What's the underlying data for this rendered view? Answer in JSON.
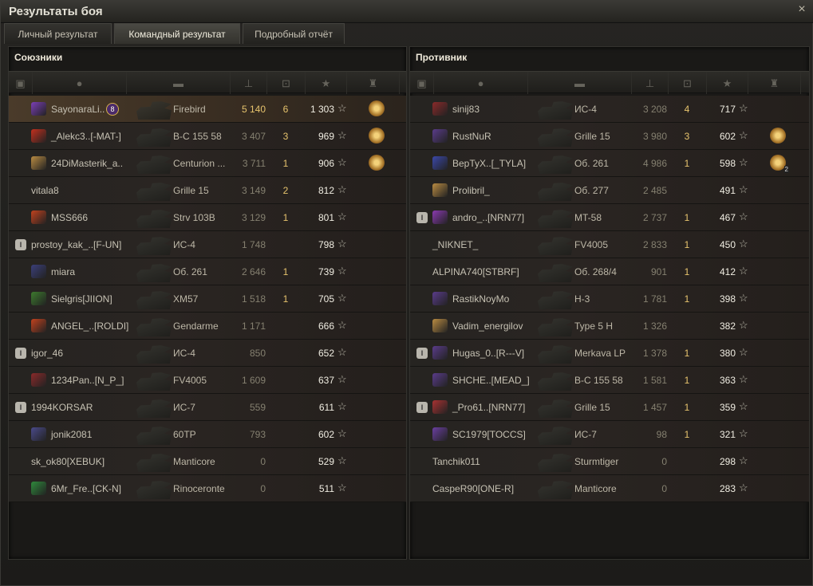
{
  "window": {
    "title": "Результаты боя",
    "close_icon": "×"
  },
  "tabs": [
    {
      "label": "Личный результат"
    },
    {
      "label": "Командный результат",
      "active": true
    },
    {
      "label": "Подробный отчёт"
    }
  ],
  "colors": {
    "accent_gold": "#e6c36d",
    "highlight_row": "#4a3b2a"
  },
  "allies": {
    "title": "Союзники",
    "header_icons": [
      "platoon-icon",
      "player-icon",
      "tank-icon",
      "damage-icon",
      "kills-icon",
      "xp-icon",
      "medal-icon"
    ],
    "rows": [
      {
        "name": "SayonaraLi..",
        "platoon": "",
        "clan_color": "#7b3fb6",
        "badge": "8",
        "tank": "Firebird",
        "damage": "5 140",
        "kills": "6",
        "xp": "1 303",
        "medal": true,
        "medal_count": "",
        "me": true
      },
      {
        "name": "_Alekc3..[-MAT-]",
        "platoon": "",
        "clan_color": "#c4301e",
        "badge": "",
        "tank": "B-C 155 58",
        "damage": "3 407",
        "kills": "3",
        "xp": "969",
        "medal": true,
        "medal_count": ""
      },
      {
        "name": "24DiMasterik_a..",
        "platoon": "",
        "clan_color": "#b98b42",
        "badge": "",
        "tank": "Centurion ...",
        "damage": "3 711",
        "kills": "1",
        "xp": "906",
        "medal": true,
        "medal_count": ""
      },
      {
        "name": "vitala8",
        "platoon": "",
        "clan_color": "",
        "badge": "",
        "tank": "Grille 15",
        "damage": "3 149",
        "kills": "2",
        "xp": "812",
        "medal": false,
        "medal_count": ""
      },
      {
        "name": "MSS666",
        "platoon": "",
        "clan_color": "#c2421e",
        "badge": "",
        "tank": "Strv 103B",
        "damage": "3 129",
        "kills": "1",
        "xp": "801",
        "medal": false,
        "medal_count": ""
      },
      {
        "name": "prostoy_kak_..[F-UN]",
        "platoon": "I",
        "clan_color": "",
        "badge": "",
        "tank": "ИС-4",
        "damage": "1 748",
        "kills": "",
        "xp": "798",
        "medal": false,
        "medal_count": ""
      },
      {
        "name": "miara",
        "platoon": "",
        "clan_color": "#3b3f7a",
        "badge": "",
        "tank": "Об. 261",
        "damage": "2 646",
        "kills": "1",
        "xp": "739",
        "medal": false,
        "medal_count": ""
      },
      {
        "name": "Sielgris[JIION]",
        "platoon": "",
        "clan_color": "#3d7a2e",
        "badge": "",
        "tank": "XM57",
        "damage": "1 518",
        "kills": "1",
        "xp": "705",
        "medal": false,
        "medal_count": ""
      },
      {
        "name": "ANGEL_..[ROLDI]",
        "platoon": "",
        "clan_color": "#c2421e",
        "badge": "",
        "tank": "Gendarme",
        "damage": "1 171",
        "kills": "",
        "xp": "666",
        "medal": false,
        "medal_count": ""
      },
      {
        "name": "igor_46",
        "platoon": "I",
        "clan_color": "",
        "badge": "",
        "tank": "ИС-4",
        "damage": "850",
        "kills": "",
        "xp": "652",
        "medal": false,
        "medal_count": ""
      },
      {
        "name": "1234Pan..[N_P_]",
        "platoon": "",
        "clan_color": "#8a2a2a",
        "badge": "",
        "tank": "FV4005",
        "damage": "1 609",
        "kills": "",
        "xp": "637",
        "medal": false,
        "medal_count": ""
      },
      {
        "name": "1994KORSAR",
        "platoon": "I",
        "clan_color": "",
        "badge": "",
        "tank": "ИС-7",
        "damage": "559",
        "kills": "",
        "xp": "611",
        "medal": false,
        "medal_count": ""
      },
      {
        "name": "jonik2081",
        "platoon": "",
        "clan_color": "#4a4a8a",
        "badge": "",
        "tank": "60TP",
        "damage": "793",
        "kills": "",
        "xp": "602",
        "medal": false,
        "medal_count": ""
      },
      {
        "name": "sk_ok80[XEBUK]",
        "platoon": "",
        "clan_color": "",
        "badge": "",
        "tank": "Manticore",
        "damage": "0",
        "kills": "",
        "xp": "529",
        "medal": false,
        "medal_count": ""
      },
      {
        "name": "6Mr_Fre..[CK-N]",
        "platoon": "",
        "clan_color": "#2f8a3c",
        "badge": "",
        "tank": "Rinoceronte",
        "damage": "0",
        "kills": "",
        "xp": "511",
        "medal": false,
        "medal_count": ""
      }
    ]
  },
  "enemies": {
    "title": "Противник",
    "header_icons": [
      "platoon-icon",
      "player-icon",
      "tank-icon",
      "damage-icon",
      "kills-icon",
      "xp-icon",
      "medal-icon"
    ],
    "rows": [
      {
        "name": "sinij83",
        "platoon": "",
        "clan_color": "#8a2a2a",
        "tank": "ИС-4",
        "damage": "3 208",
        "kills": "4",
        "xp": "717",
        "medal": false,
        "medal_count": ""
      },
      {
        "name": "RustNuR",
        "platoon": "",
        "clan_color": "#5a3c8a",
        "tank": "Grille 15",
        "damage": "3 980",
        "kills": "3",
        "xp": "602",
        "medal": true,
        "medal_count": ""
      },
      {
        "name": "ВерТуХ..[_TYLA]",
        "platoon": "",
        "clan_color": "#3b48a8",
        "tank": "Об. 261",
        "damage": "4 986",
        "kills": "1",
        "xp": "598",
        "medal": true,
        "medal_count": "2"
      },
      {
        "name": "Prolibril_",
        "platoon": "",
        "clan_color": "#b98b42",
        "tank": "Об. 277",
        "damage": "2 485",
        "kills": "",
        "xp": "491",
        "medal": false,
        "medal_count": ""
      },
      {
        "name": "andro_..[NRN77]",
        "platoon": "I",
        "clan_color": "#8a3ab0",
        "tank": "MT-58",
        "damage": "2 737",
        "kills": "1",
        "xp": "467",
        "medal": false,
        "medal_count": ""
      },
      {
        "name": "_NIKNET_",
        "platoon": "",
        "clan_color": "",
        "tank": "FV4005",
        "damage": "2 833",
        "kills": "1",
        "xp": "450",
        "medal": false,
        "medal_count": ""
      },
      {
        "name": "ALPINA740[STBRF]",
        "platoon": "",
        "clan_color": "",
        "tank": "Об. 268/4",
        "damage": "901",
        "kills": "1",
        "xp": "412",
        "medal": false,
        "medal_count": ""
      },
      {
        "name": "RastikNoyMo",
        "platoon": "",
        "clan_color": "#5a3c8a",
        "tank": "H-3",
        "damage": "1 781",
        "kills": "1",
        "xp": "398",
        "medal": false,
        "medal_count": ""
      },
      {
        "name": "Vadim_energilov",
        "platoon": "",
        "clan_color": "#b98b42",
        "tank": "Type 5 H",
        "damage": "1 326",
        "kills": "",
        "xp": "382",
        "medal": false,
        "medal_count": ""
      },
      {
        "name": "Hugas_0..[R---V]",
        "platoon": "I",
        "clan_color": "#5a3c8a",
        "tank": "Merkava LP",
        "damage": "1 378",
        "kills": "1",
        "xp": "380",
        "medal": false,
        "medal_count": ""
      },
      {
        "name": "SHCHE..[MEAD_]",
        "platoon": "",
        "clan_color": "#5a3c8a",
        "tank": "B-C 155 58",
        "damage": "1 581",
        "kills": "1",
        "xp": "363",
        "medal": false,
        "medal_count": ""
      },
      {
        "name": "_Pro61..[NRN77]",
        "platoon": "I",
        "clan_color": "#a83232",
        "tank": "Grille 15",
        "damage": "1 457",
        "kills": "1",
        "xp": "359",
        "medal": false,
        "medal_count": ""
      },
      {
        "name": "SC1979[TOCCS]",
        "platoon": "",
        "clan_color": "#6a3fa0",
        "tank": "ИС-7",
        "damage": "98",
        "kills": "1",
        "xp": "321",
        "medal": false,
        "medal_count": ""
      },
      {
        "name": "Tanchik011",
        "platoon": "",
        "clan_color": "",
        "tank": "Sturmtiger",
        "damage": "0",
        "kills": "",
        "xp": "298",
        "medal": false,
        "medal_count": ""
      },
      {
        "name": "CaspeR90[ONE-R]",
        "platoon": "",
        "clan_color": "",
        "tank": "Manticore",
        "damage": "0",
        "kills": "",
        "xp": "283",
        "medal": false,
        "medal_count": ""
      }
    ]
  },
  "star_glyph": "☆"
}
